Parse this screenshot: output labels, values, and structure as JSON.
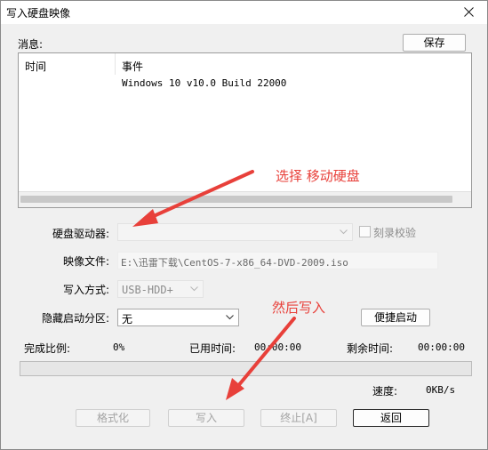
{
  "window": {
    "title": "写入硬盘映像"
  },
  "messages": {
    "label": "消息:",
    "save_label": "保存",
    "columns": {
      "time": "时间",
      "event": "事件"
    },
    "rows": [
      {
        "time": "",
        "event": "Windows 10 v10.0 Build 22000"
      }
    ]
  },
  "form": {
    "drive": {
      "label": "硬盘驱动器:",
      "value": ""
    },
    "verify": {
      "label": "刻录校验",
      "checked": false
    },
    "image_file": {
      "label": "映像文件:",
      "value": "E:\\迅雷下载\\CentOS-7-x86_64-DVD-2009.iso"
    },
    "write_method": {
      "label": "写入方式:",
      "value": "USB-HDD+"
    },
    "hidden_partition": {
      "label": "隐藏启动分区:",
      "value": "无"
    },
    "quick_boot_label": "便捷启动"
  },
  "status": {
    "completion_label": "完成比例:",
    "completion_value": "0%",
    "progress_fraction": 0,
    "elapsed_label": "已用时间:",
    "elapsed_value": "00:00:00",
    "remaining_label": "剩余时间:",
    "remaining_value": "00:00:00",
    "speed_label": "速度:",
    "speed_value": "0KB/s"
  },
  "actions": {
    "format_label": "格式化",
    "write_label": "写入",
    "abort_label": "终止[A]",
    "return_label": "返回"
  },
  "annotations": {
    "select_drive": "选择 移动硬盘",
    "then_write": "然后写入",
    "color": "#e8403a"
  }
}
